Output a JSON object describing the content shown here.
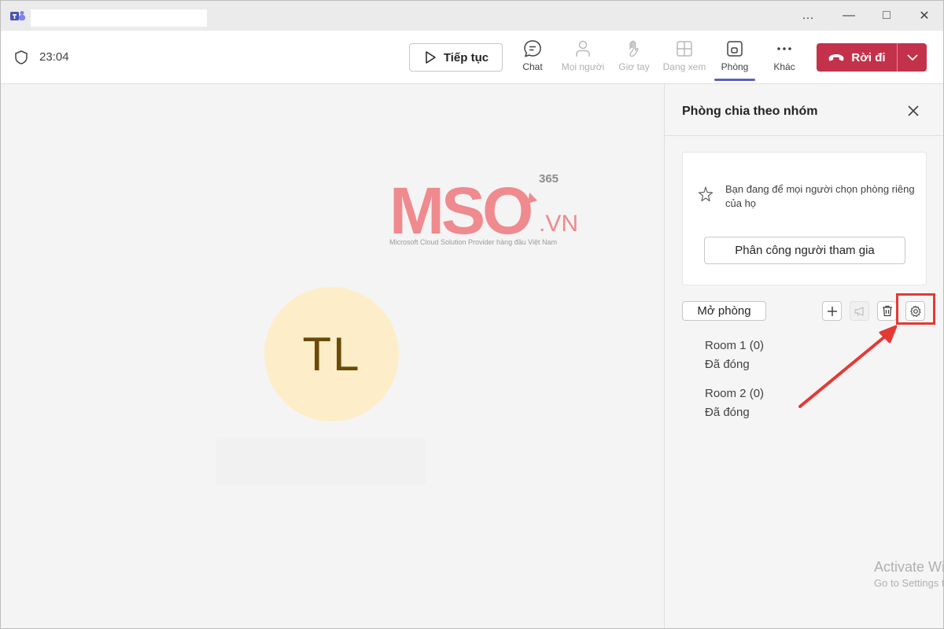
{
  "titlebar": {
    "more": "…",
    "minimize": "—",
    "maximize": "□",
    "close": "✕"
  },
  "toolbar": {
    "timer": "23:04",
    "resume_label": "Tiếp tục",
    "tools": {
      "chat": "Chat",
      "people": "Mọi người",
      "raise_hand": "Giơ tay",
      "view": "Dạng xem",
      "rooms": "Phòng",
      "more": "Khác"
    },
    "leave_label": "Rời đi"
  },
  "stage": {
    "avatar_initials": "TL"
  },
  "logo": {
    "brand": "MSO",
    "suffix": ".VN",
    "superscript": "365",
    "tagline": "Microsoft Cloud Solution Provider hàng đầu Việt Nam"
  },
  "panel": {
    "title": "Phòng chia theo nhóm",
    "info_text": "Bạn đang để mọi người chọn phòng riêng của họ",
    "assign_label": "Phân công người tham gia",
    "open_rooms_label": "Mở phòng",
    "rooms": [
      {
        "name": "Room 1",
        "count": "(0)",
        "status": "Đã đóng"
      },
      {
        "name": "Room 2",
        "count": "(0)",
        "status": "Đã đóng"
      }
    ]
  },
  "watermark": {
    "title": "Activate Windows",
    "subtitle": "Go to Settings to activate Windows."
  },
  "colors": {
    "accent": "#5b5fc7",
    "leave": "#c4314b",
    "highlight": "#e53935",
    "logo": "#ef8a8e"
  }
}
